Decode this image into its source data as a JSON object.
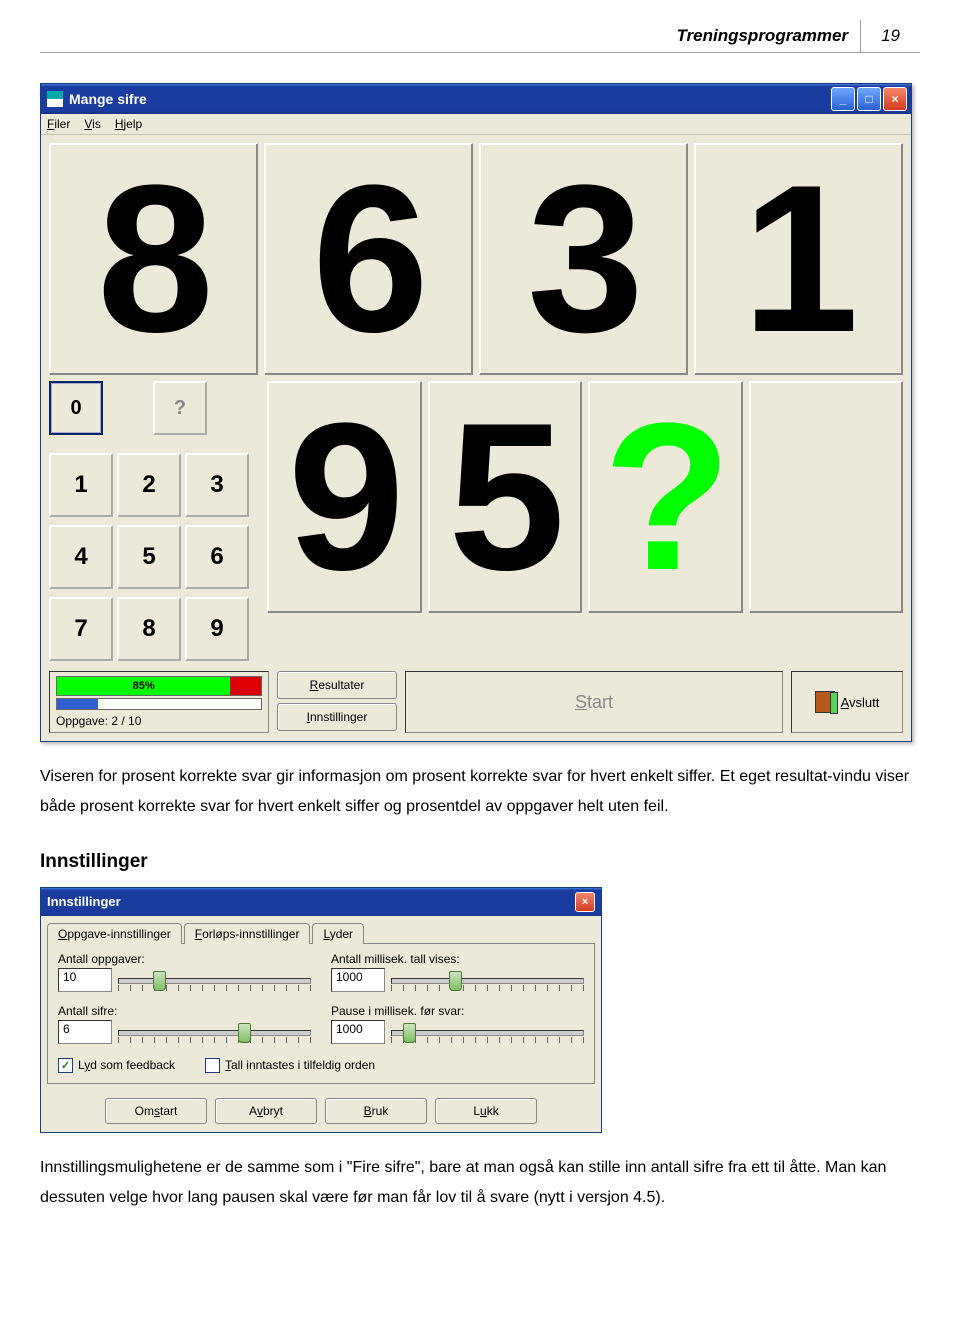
{
  "page": {
    "header_title": "Treningsprogrammer",
    "page_number": "19"
  },
  "app": {
    "title": "Mange sifre",
    "menu": {
      "file": "Filer",
      "view": "Vis",
      "help": "Hjelp"
    },
    "titlebar_buttons": {
      "min": "_",
      "max": "□",
      "close": "×"
    },
    "top_digits": [
      "8",
      "6",
      "3",
      "1"
    ],
    "bottom_digits": [
      "9",
      "5",
      "?",
      ""
    ],
    "keypad": {
      "zero": "0",
      "question": "?",
      "keys": [
        "1",
        "2",
        "3",
        "4",
        "5",
        "6",
        "7",
        "8",
        "9"
      ]
    },
    "progress": {
      "pct_label": "85%",
      "pct_value": 85,
      "task_label": "Oppgave:  2 / 10",
      "task_progress": 20
    },
    "buttons": {
      "results": "Resultater",
      "settings": "Innstillinger",
      "start": "Start",
      "quit": "Avslutt"
    }
  },
  "para1": "Viseren for prosent korrekte svar gir informasjon om prosent korrekte svar for hvert enkelt siffer. Et eget resultat-vindu viser både prosent korrekte svar for hvert enkelt siffer og prosentdel av oppgaver helt uten feil.",
  "h_settings": "Innstillinger",
  "dialog": {
    "title": "Innstillinger",
    "tabs": [
      "Oppgave-innstillinger",
      "Forløps-innstillinger",
      "Lyder"
    ],
    "labels": {
      "antall_oppgaver": "Antall oppgaver:",
      "antall_ms_vises": "Antall millisek. tall vises:",
      "antall_sifre": "Antall sifre:",
      "pause_ms": "Pause i millisek. før svar:",
      "lyd_feedback": "Lyd som feedback",
      "tilfeldig": "Tall inntastes i tilfeldig orden"
    },
    "values": {
      "antall_oppgaver": "10",
      "antall_ms_vises": "1000",
      "antall_sifre": "6",
      "pause_ms": "1000",
      "lyd_feedback_checked": true,
      "tilfeldig_checked": false
    },
    "buttons": {
      "restart": "Omstart",
      "cancel": "Avbryt",
      "apply": "Bruk",
      "close": "Lukk"
    }
  },
  "para2": "Innstillingsmulighetene er de samme som i \"Fire sifre\", bare at man også kan stille inn antall sifre fra ett til åtte. Man kan dessuten velge hvor lang pausen skal være før man får lov til å svare (nytt i versjon 4.5)."
}
